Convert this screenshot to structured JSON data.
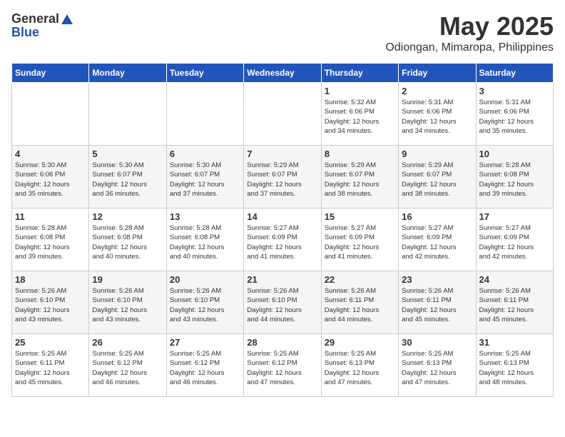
{
  "header": {
    "logo_general": "General",
    "logo_blue": "Blue",
    "title": "May 2025",
    "location": "Odiongan, Mimaropa, Philippines"
  },
  "days_of_week": [
    "Sunday",
    "Monday",
    "Tuesday",
    "Wednesday",
    "Thursday",
    "Friday",
    "Saturday"
  ],
  "weeks": [
    [
      {
        "day": "",
        "info": ""
      },
      {
        "day": "",
        "info": ""
      },
      {
        "day": "",
        "info": ""
      },
      {
        "day": "",
        "info": ""
      },
      {
        "day": "1",
        "info": "Sunrise: 5:32 AM\nSunset: 6:06 PM\nDaylight: 12 hours\nand 34 minutes."
      },
      {
        "day": "2",
        "info": "Sunrise: 5:31 AM\nSunset: 6:06 PM\nDaylight: 12 hours\nand 34 minutes."
      },
      {
        "day": "3",
        "info": "Sunrise: 5:31 AM\nSunset: 6:06 PM\nDaylight: 12 hours\nand 35 minutes."
      }
    ],
    [
      {
        "day": "4",
        "info": "Sunrise: 5:30 AM\nSunset: 6:06 PM\nDaylight: 12 hours\nand 35 minutes."
      },
      {
        "day": "5",
        "info": "Sunrise: 5:30 AM\nSunset: 6:07 PM\nDaylight: 12 hours\nand 36 minutes."
      },
      {
        "day": "6",
        "info": "Sunrise: 5:30 AM\nSunset: 6:07 PM\nDaylight: 12 hours\nand 37 minutes."
      },
      {
        "day": "7",
        "info": "Sunrise: 5:29 AM\nSunset: 6:07 PM\nDaylight: 12 hours\nand 37 minutes."
      },
      {
        "day": "8",
        "info": "Sunrise: 5:29 AM\nSunset: 6:07 PM\nDaylight: 12 hours\nand 38 minutes."
      },
      {
        "day": "9",
        "info": "Sunrise: 5:29 AM\nSunset: 6:07 PM\nDaylight: 12 hours\nand 38 minutes."
      },
      {
        "day": "10",
        "info": "Sunrise: 5:28 AM\nSunset: 6:08 PM\nDaylight: 12 hours\nand 39 minutes."
      }
    ],
    [
      {
        "day": "11",
        "info": "Sunrise: 5:28 AM\nSunset: 6:08 PM\nDaylight: 12 hours\nand 39 minutes."
      },
      {
        "day": "12",
        "info": "Sunrise: 5:28 AM\nSunset: 6:08 PM\nDaylight: 12 hours\nand 40 minutes."
      },
      {
        "day": "13",
        "info": "Sunrise: 5:28 AM\nSunset: 6:08 PM\nDaylight: 12 hours\nand 40 minutes."
      },
      {
        "day": "14",
        "info": "Sunrise: 5:27 AM\nSunset: 6:09 PM\nDaylight: 12 hours\nand 41 minutes."
      },
      {
        "day": "15",
        "info": "Sunrise: 5:27 AM\nSunset: 6:09 PM\nDaylight: 12 hours\nand 41 minutes."
      },
      {
        "day": "16",
        "info": "Sunrise: 5:27 AM\nSunset: 6:09 PM\nDaylight: 12 hours\nand 42 minutes."
      },
      {
        "day": "17",
        "info": "Sunrise: 5:27 AM\nSunset: 6:09 PM\nDaylight: 12 hours\nand 42 minutes."
      }
    ],
    [
      {
        "day": "18",
        "info": "Sunrise: 5:26 AM\nSunset: 6:10 PM\nDaylight: 12 hours\nand 43 minutes."
      },
      {
        "day": "19",
        "info": "Sunrise: 5:26 AM\nSunset: 6:10 PM\nDaylight: 12 hours\nand 43 minutes."
      },
      {
        "day": "20",
        "info": "Sunrise: 5:26 AM\nSunset: 6:10 PM\nDaylight: 12 hours\nand 43 minutes."
      },
      {
        "day": "21",
        "info": "Sunrise: 5:26 AM\nSunset: 6:10 PM\nDaylight: 12 hours\nand 44 minutes."
      },
      {
        "day": "22",
        "info": "Sunrise: 5:26 AM\nSunset: 6:11 PM\nDaylight: 12 hours\nand 44 minutes."
      },
      {
        "day": "23",
        "info": "Sunrise: 5:26 AM\nSunset: 6:11 PM\nDaylight: 12 hours\nand 45 minutes."
      },
      {
        "day": "24",
        "info": "Sunrise: 5:26 AM\nSunset: 6:11 PM\nDaylight: 12 hours\nand 45 minutes."
      }
    ],
    [
      {
        "day": "25",
        "info": "Sunrise: 5:25 AM\nSunset: 6:11 PM\nDaylight: 12 hours\nand 45 minutes."
      },
      {
        "day": "26",
        "info": "Sunrise: 5:25 AM\nSunset: 6:12 PM\nDaylight: 12 hours\nand 46 minutes."
      },
      {
        "day": "27",
        "info": "Sunrise: 5:25 AM\nSunset: 6:12 PM\nDaylight: 12 hours\nand 46 minutes."
      },
      {
        "day": "28",
        "info": "Sunrise: 5:25 AM\nSunset: 6:12 PM\nDaylight: 12 hours\nand 47 minutes."
      },
      {
        "day": "29",
        "info": "Sunrise: 5:25 AM\nSunset: 6:13 PM\nDaylight: 12 hours\nand 47 minutes."
      },
      {
        "day": "30",
        "info": "Sunrise: 5:25 AM\nSunset: 6:13 PM\nDaylight: 12 hours\nand 47 minutes."
      },
      {
        "day": "31",
        "info": "Sunrise: 5:25 AM\nSunset: 6:13 PM\nDaylight: 12 hours\nand 48 minutes."
      }
    ]
  ]
}
